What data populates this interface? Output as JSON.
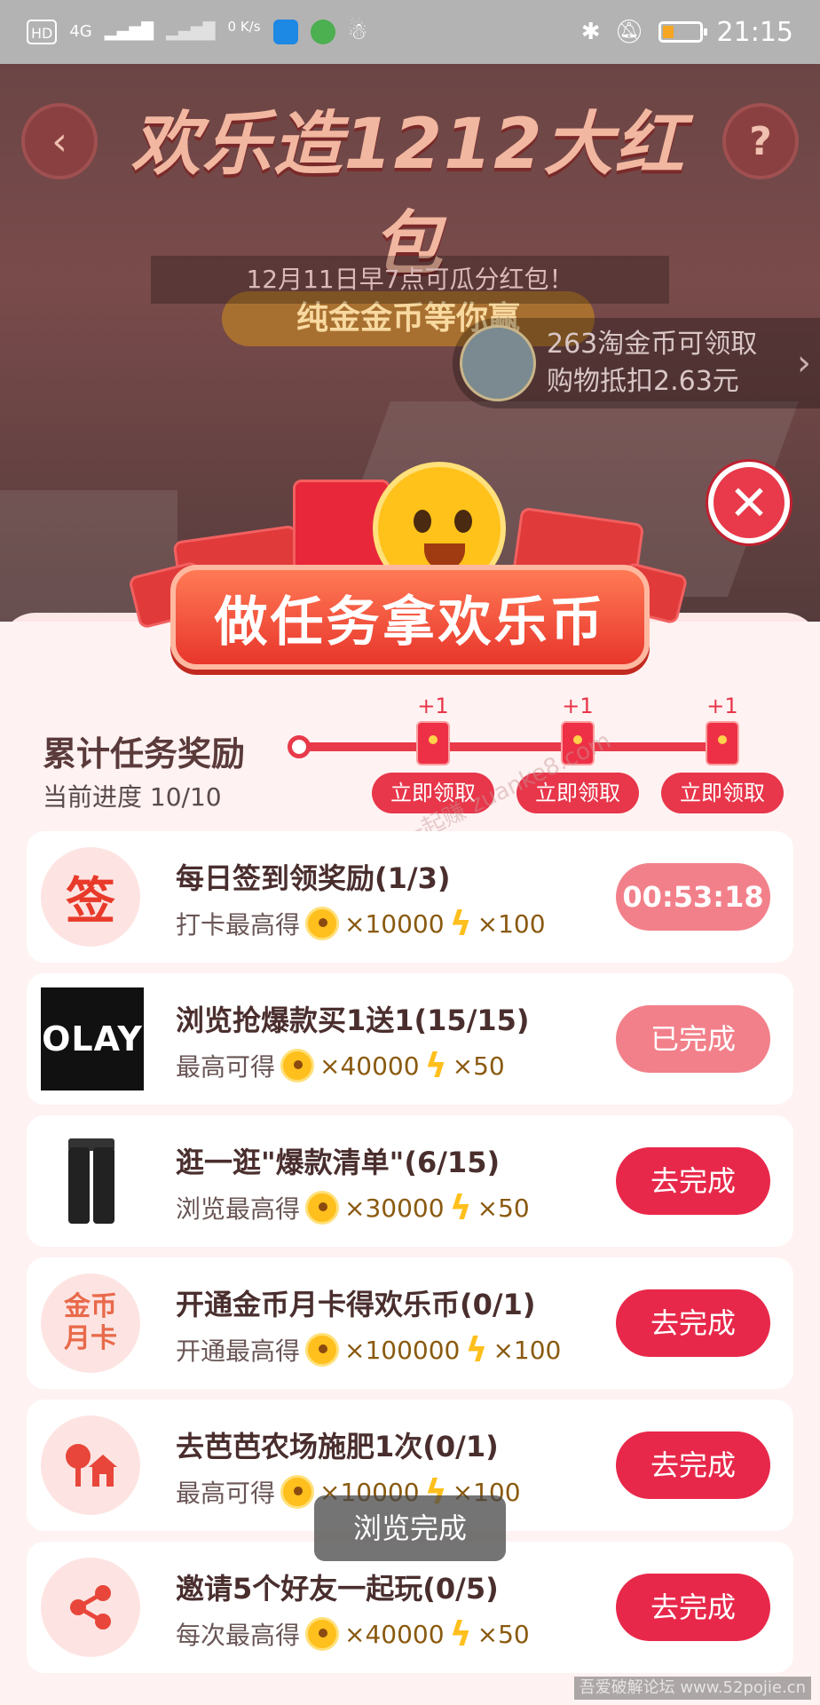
{
  "status_bar": {
    "left": [
      "HD",
      "4G",
      "0 K/s"
    ],
    "time": "21:15"
  },
  "header": {
    "banner_title": "欢乐造1212大红包",
    "banner_subtitle": "纯金金币等你赢",
    "notice": "12月11日早7点可瓜分红包！",
    "coin_line1": "263淘金币可领取",
    "coin_line2": "购物抵扣2.63元"
  },
  "popup": {
    "title": "做任务拿欢乐币",
    "progress_title": "累计任务奖励",
    "progress_sub": "当前进度 10/10",
    "milestones": [
      {
        "plus": "+1",
        "label": "立即领取"
      },
      {
        "plus": "+1",
        "label": "立即领取"
      },
      {
        "plus": "+1",
        "label": "立即领取"
      }
    ]
  },
  "tasks": [
    {
      "icon_text": "签",
      "title": "每日签到领奖励(1/3)",
      "prefix": "打卡最高得",
      "coins": "×10000",
      "bolts": "×100",
      "button": "00:53:18"
    },
    {
      "icon_text": "OLAY",
      "title": "浏览抢爆款买1送1(15/15)",
      "prefix": "最高可得",
      "coins": "×40000",
      "bolts": "×50",
      "button": "已完成"
    },
    {
      "icon_text": "",
      "title": "逛一逛\"爆款清单\"(6/15)",
      "prefix": "浏览最高得",
      "coins": "×30000",
      "bolts": "×50",
      "button": "去完成"
    },
    {
      "icon_text": "金币月卡",
      "title": "开通金币月卡得欢乐币(0/1)",
      "prefix": "开通最高得",
      "coins": "×100000",
      "bolts": "×100",
      "button": "去完成"
    },
    {
      "icon_text": "",
      "title": "去芭芭农场施肥1次(0/1)",
      "prefix": "最高可得",
      "coins": "×10000",
      "bolts": "×100",
      "button": "去完成"
    },
    {
      "icon_text": "",
      "title": "邀请5个好友一起玩(0/5)",
      "prefix": "每次最高得",
      "coins": "×40000",
      "bolts": "×50",
      "button": "去完成"
    }
  ],
  "toast": "浏览完成",
  "watermark": "有奖一起赚 zuanke8.com",
  "footer_watermark": "吾爱破解论坛 www.52pojie.cn",
  "colors": {
    "accent": "#e8284a",
    "done": "#f2808a",
    "panel": "#fff2f2"
  }
}
